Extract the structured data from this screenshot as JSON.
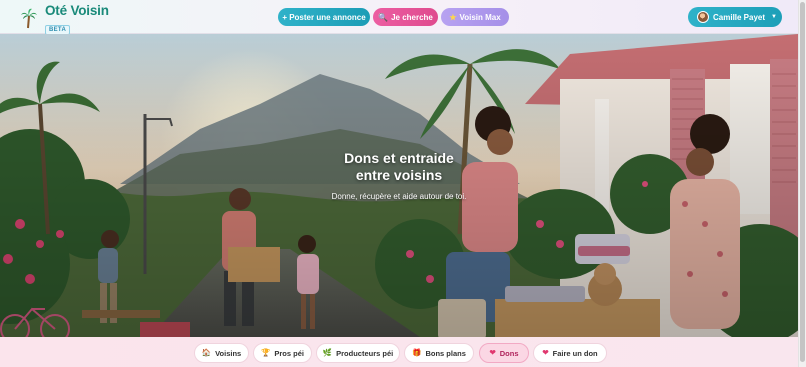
{
  "header": {
    "brand_name": "Oté Voisin",
    "badge": "BETA",
    "buttons": {
      "post": "+ Poster une annonce",
      "search": "Je cherche",
      "max": "Voisin Max"
    },
    "user": {
      "name": "Camille Payet"
    }
  },
  "hero": {
    "title_line1": "Dons et entraide",
    "title_line2": "entre voisins",
    "subtitle": "Donne, récupère et aide autour de toi."
  },
  "nav": {
    "items": [
      {
        "label": "Voisins",
        "icon": "house-icon",
        "glyph": "🏠"
      },
      {
        "label": "Pros péi",
        "icon": "trophy-icon",
        "glyph": "🏆"
      },
      {
        "label": "Producteurs péi",
        "icon": "leaf-icon",
        "glyph": "🌿"
      },
      {
        "label": "Bons plans",
        "icon": "gift-icon",
        "glyph": "🎁"
      },
      {
        "label": "Dons",
        "icon": "heart-icon",
        "glyph": "❤"
      },
      {
        "label": "Faire un don",
        "icon": "heart-icon",
        "glyph": "❤"
      }
    ],
    "active": "Dons"
  },
  "colors": {
    "brand": "#1a8a7a",
    "primary": "#1d9fb8",
    "pink": "#df4a8e",
    "purple": "#a58fe8",
    "active_pill": "#fbd7e4"
  }
}
